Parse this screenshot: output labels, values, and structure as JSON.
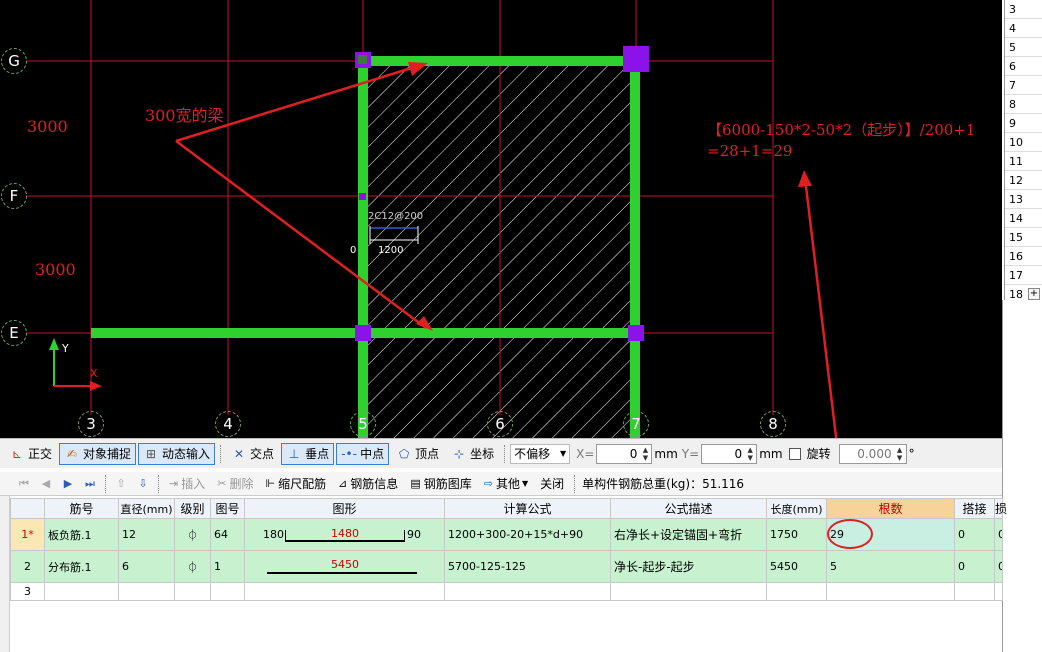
{
  "cad": {
    "axis_letters": [
      "G",
      "F",
      "E"
    ],
    "axis_numbers": [
      "3",
      "4",
      "5",
      "6",
      "7",
      "8"
    ],
    "dim_labels": [
      "3000",
      "3000"
    ],
    "beam_note": "300宽的梁",
    "rebar_label": "2C12@200",
    "rebar_length": "1200",
    "rebar_prefix": "0",
    "formula_line1": "【6000-150*2-50*2（起步）】/200+1",
    "formula_line2": "=28+1=29",
    "ucs_y": "Y",
    "ucs_x": "X",
    "colors": {
      "grid": "#c8102e",
      "beam": "#2fd12f",
      "node": "#8b12e8",
      "annotation": "#e02020",
      "background": "#000000"
    }
  },
  "row_numbers": [
    "3",
    "4",
    "5",
    "6",
    "7",
    "8",
    "9",
    "10",
    "11",
    "12",
    "13",
    "14",
    "15",
    "16",
    "17",
    "18"
  ],
  "toolbar1": {
    "ortho": "正交",
    "snap": "对象捕捉",
    "dynamic": "动态输入",
    "intersection": "交点",
    "perpendicular": "垂点",
    "midpoint": "中点",
    "vertex": "顶点",
    "coord": "坐标",
    "offset_mode": "不偏移",
    "x_label": "X=",
    "x_value": "0",
    "mm1": "mm",
    "y_label": "Y=",
    "y_value": "0",
    "mm2": "mm",
    "rotate_label": "旋转",
    "rotate_value": "0.000",
    "degree": "°"
  },
  "toolbar2": {
    "insert": "插入",
    "delete": "删除",
    "scale_rebar": "缩尺配筋",
    "rebar_info": "钢筋信息",
    "rebar_library": "钢筋图库",
    "other": "其他",
    "close": "关闭",
    "total_label": "单构件钢筋总重(kg)：51.116"
  },
  "table": {
    "headers": [
      "",
      "筋号",
      "直径(mm)",
      "级别",
      "图号",
      "图形",
      "计算公式",
      "公式描述",
      "长度(mm)",
      "根数",
      "搭接",
      "损"
    ],
    "rows": [
      {
        "num": "1*",
        "name": "板负筋.1",
        "dia": "12",
        "grade": "⏀",
        "fig": "64",
        "shape_left": "180",
        "shape_mid": "1480",
        "shape_right": "90",
        "formula": "1200+300-20+15*d+90",
        "desc": "右净长+设定锚固+弯折",
        "length": "1750",
        "count": "29",
        "lap": "0",
        "loss": "0"
      },
      {
        "num": "2",
        "name": "分布筋.1",
        "dia": "6",
        "grade": "⏀",
        "fig": "1",
        "shape_left": "",
        "shape_mid": "5450",
        "shape_right": "",
        "formula": "5700-125-125",
        "desc": "净长-起步-起步",
        "length": "5450",
        "count": "5",
        "lap": "0",
        "loss": "0"
      },
      {
        "num": "3",
        "name": "",
        "dia": "",
        "grade": "",
        "fig": "",
        "shape_left": "",
        "shape_mid": "",
        "shape_right": "",
        "formula": "",
        "desc": "",
        "length": "",
        "count": "",
        "lap": "",
        "loss": ""
      }
    ]
  }
}
